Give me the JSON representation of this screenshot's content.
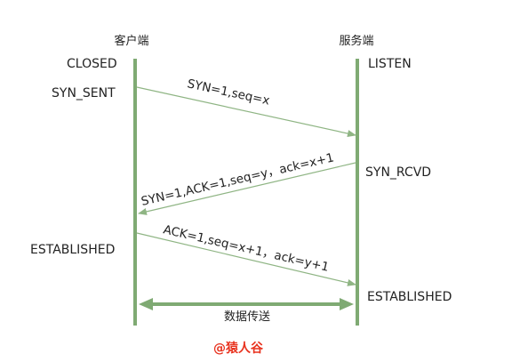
{
  "headers": {
    "client": "客户端",
    "server": "服务端"
  },
  "client_states": {
    "closed": "CLOSED",
    "syn_sent": "SYN_SENT",
    "established": "ESTABLISHED"
  },
  "server_states": {
    "listen": "LISTEN",
    "syn_rcvd": "SYN_RCVD",
    "established": "ESTABLISHED"
  },
  "messages": {
    "syn": "SYN=1,seq=x",
    "syn_ack": "SYN=1,ACK=1,seq=y，ack=x+1",
    "ack": "ACK=1,seq=x+1，ack=y+1"
  },
  "data_transfer": "数据传送",
  "watermark": "@猿人谷",
  "colors": {
    "lifeline": "#7faa73",
    "arrow": "#8fb584",
    "text": "#222222",
    "watermark": "#e8321e"
  }
}
